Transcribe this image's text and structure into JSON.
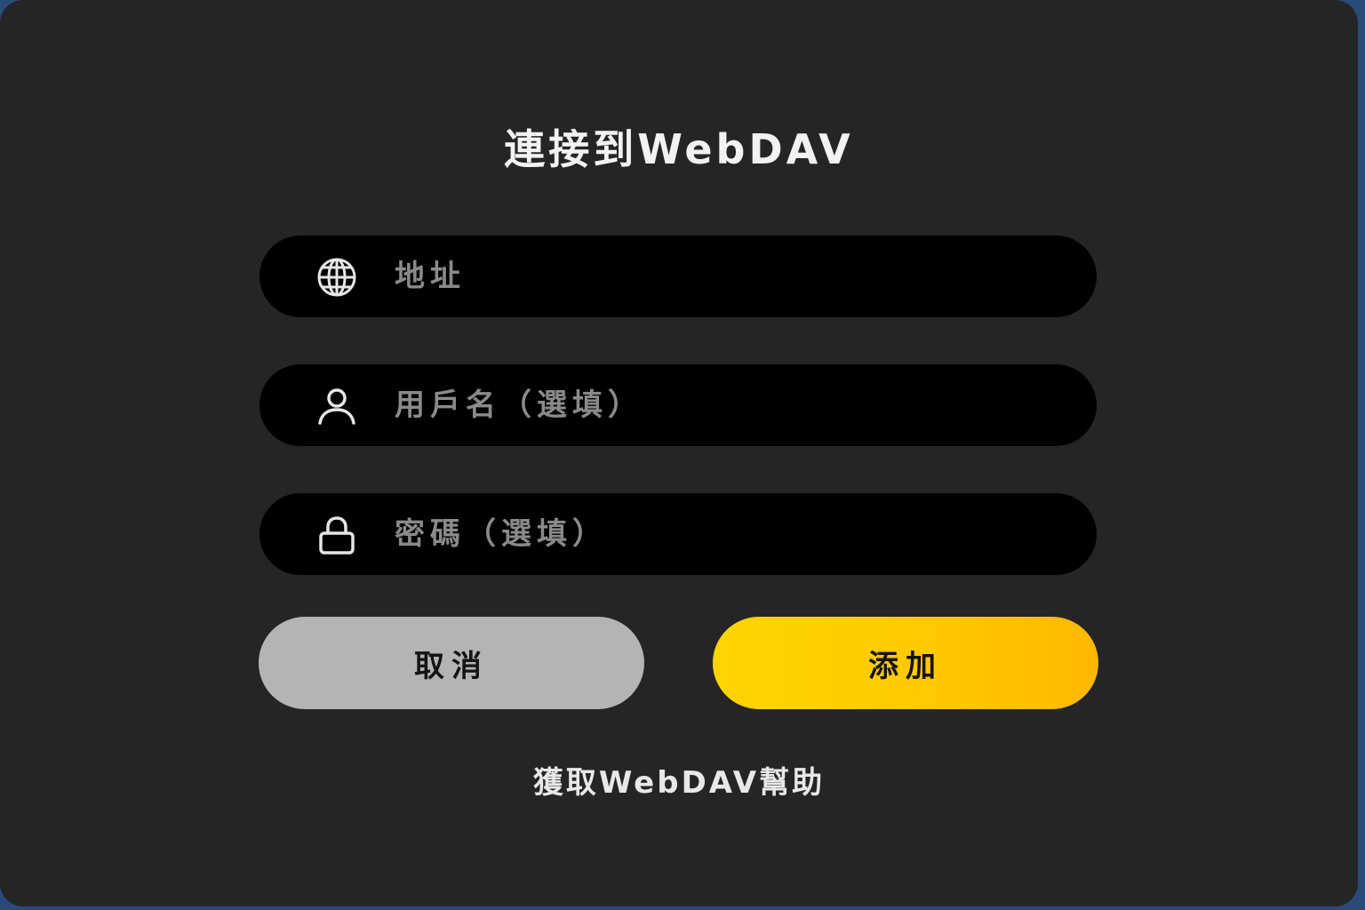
{
  "dialog": {
    "title": "連接到WebDAV",
    "fields": {
      "address": {
        "icon": "globe-icon",
        "placeholder": "地址",
        "value": ""
      },
      "username": {
        "icon": "user-icon",
        "placeholder": "用戶名（選填）",
        "value": ""
      },
      "password": {
        "icon": "lock-icon",
        "placeholder": "密碼（選填）",
        "value": ""
      }
    },
    "buttons": {
      "cancel_label": "取消",
      "add_label": "添加"
    },
    "help_link": "獲取WebDAV幫助"
  },
  "colors": {
    "dialog_background": "#252525",
    "field_background": "#000000",
    "cancel_button": "#b4b4b4",
    "add_button": "#ffc800",
    "placeholder_text": "#8a8a8a",
    "title_text": "#f2f2f2"
  }
}
